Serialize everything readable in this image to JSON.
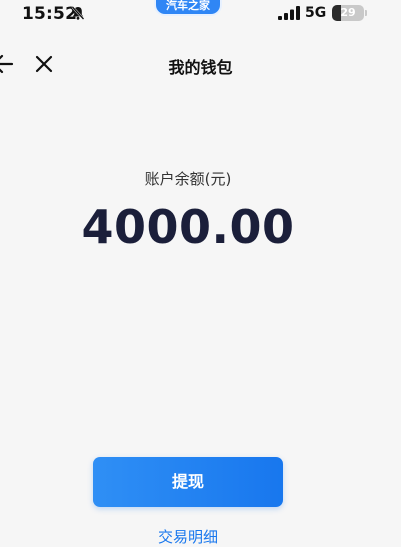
{
  "status_bar": {
    "time": "15:52",
    "app_badge": "汽车之家",
    "network": "5G",
    "battery_level": "29",
    "battery_fraction": 0.29
  },
  "nav": {
    "title": "我的钱包"
  },
  "wallet": {
    "balance_label": "账户余额(元)",
    "balance_amount": "4000.00"
  },
  "actions": {
    "withdraw_label": "提现",
    "detail_link": "交易明细"
  },
  "colors": {
    "accent": "#1877ee",
    "background": "#f6f6f6",
    "amount_text": "#1b1f3a"
  },
  "icons": {
    "mute": "bell-slash-icon",
    "signal": "signal-icon",
    "back": "back-arrow-icon",
    "close": "close-icon"
  }
}
